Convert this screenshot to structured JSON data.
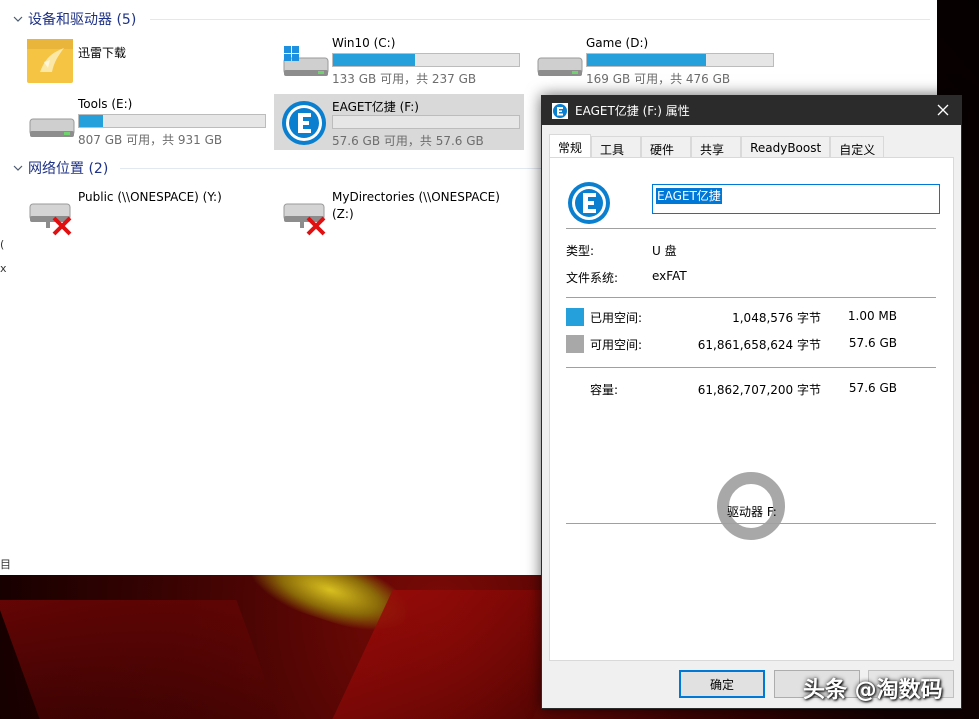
{
  "explorer": {
    "edge_text_1": "(",
    "edge_text_2": "x",
    "edge_text_3": "目",
    "devices_section": {
      "title": "设备和驱动器 (5)"
    },
    "network_section": {
      "title": "网络位置 (2)"
    },
    "drives": [
      {
        "name": "迅雷下载",
        "space": "",
        "used_fraction": null,
        "icon": "folder-icon"
      },
      {
        "name": "Win10 (C:)",
        "space": "133 GB 可用，共 237 GB",
        "used_fraction": 0.44,
        "icon": "windows-drive-icon"
      },
      {
        "name": "Game (D:)",
        "space": "169 GB 可用，共 476 GB",
        "used_fraction": 0.64,
        "icon": "hard-drive-icon"
      },
      {
        "name": "Tools (E:)",
        "space": "807 GB 可用，共 931 GB",
        "used_fraction": 0.13,
        "icon": "hard-drive-icon"
      },
      {
        "name": "EAGET亿捷 (F:)",
        "space": "57.6 GB 可用，共 57.6 GB",
        "used_fraction": 0.0,
        "icon": "eaget-drive-icon"
      }
    ],
    "network": [
      {
        "name": "Public (\\\\ONESPACE) (Y:)",
        "name_line2": "",
        "icon": "network-drive-disconnected-icon"
      },
      {
        "name": "MyDirectories (\\\\ONESPACE)",
        "name_line2": "(Z:)",
        "icon": "network-drive-disconnected-icon"
      }
    ]
  },
  "dialog": {
    "title": "EAGET亿捷 (F:) 属性",
    "tabs": [
      "常规",
      "工具",
      "硬件",
      "共享",
      "ReadyBoost",
      "自定义"
    ],
    "active_tab": 0,
    "volume_name": "EAGET亿捷",
    "type_label": "类型:",
    "type_value": "U 盘",
    "fs_label": "文件系统:",
    "fs_value": "exFAT",
    "used_label": "已用空间:",
    "used_bytes": "1,048,576 字节",
    "used_human": "1.00 MB",
    "free_label": "可用空间:",
    "free_bytes": "61,861,658,624 字节",
    "free_human": "57.6 GB",
    "capacity_label": "容量:",
    "capacity_bytes": "61,862,707,200 字节",
    "capacity_human": "57.6 GB",
    "drive_label": "驱动器 F:",
    "used_fraction": 1.69e-05,
    "ok_button": "确定",
    "colors": {
      "used": "#26a0da",
      "free": "#a8a8a8",
      "accent": "#0078d7",
      "titlebar": "#2b2b2b"
    }
  },
  "watermark": "头条 @淘数码"
}
